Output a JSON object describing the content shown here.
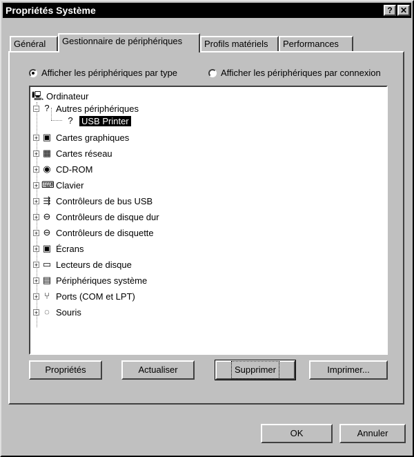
{
  "window": {
    "title": "Propriétés Système",
    "help_label": "?",
    "close_label": "✕"
  },
  "tabs": [
    {
      "label": "Général"
    },
    {
      "label": "Gestionnaire de périphériques"
    },
    {
      "label": "Profils matériels"
    },
    {
      "label": "Performances"
    }
  ],
  "view_options": {
    "by_type": "Afficher les périphériques par type",
    "by_connection": "Afficher les périphériques par connexion",
    "selected": "by_type"
  },
  "tree": {
    "root": "Ordinateur",
    "other_devices": "Autres périphériques",
    "selected_device": "USB Printer",
    "categories": [
      {
        "label": "Cartes graphiques",
        "icon": "monitor-icon"
      },
      {
        "label": "Cartes réseau",
        "icon": "network-card-icon"
      },
      {
        "label": "CD-ROM",
        "icon": "cdrom-icon"
      },
      {
        "label": "Clavier",
        "icon": "keyboard-icon"
      },
      {
        "label": "Contrôleurs de bus USB",
        "icon": "usb-icon"
      },
      {
        "label": "Contrôleurs de disque dur",
        "icon": "harddisk-icon"
      },
      {
        "label": "Contrôleurs de disquette",
        "icon": "floppy-controller-icon"
      },
      {
        "label": "Écrans",
        "icon": "screen-icon"
      },
      {
        "label": "Lecteurs de disque",
        "icon": "disk-drive-icon"
      },
      {
        "label": "Périphériques système",
        "icon": "system-device-icon"
      },
      {
        "label": "Ports (COM et LPT)",
        "icon": "port-icon"
      },
      {
        "label": "Souris",
        "icon": "mouse-icon"
      }
    ]
  },
  "buttons": {
    "properties": "Propriétés",
    "refresh": "Actualiser",
    "remove": "Supprimer",
    "print": "Imprimer...",
    "ok": "OK",
    "cancel": "Annuler"
  }
}
